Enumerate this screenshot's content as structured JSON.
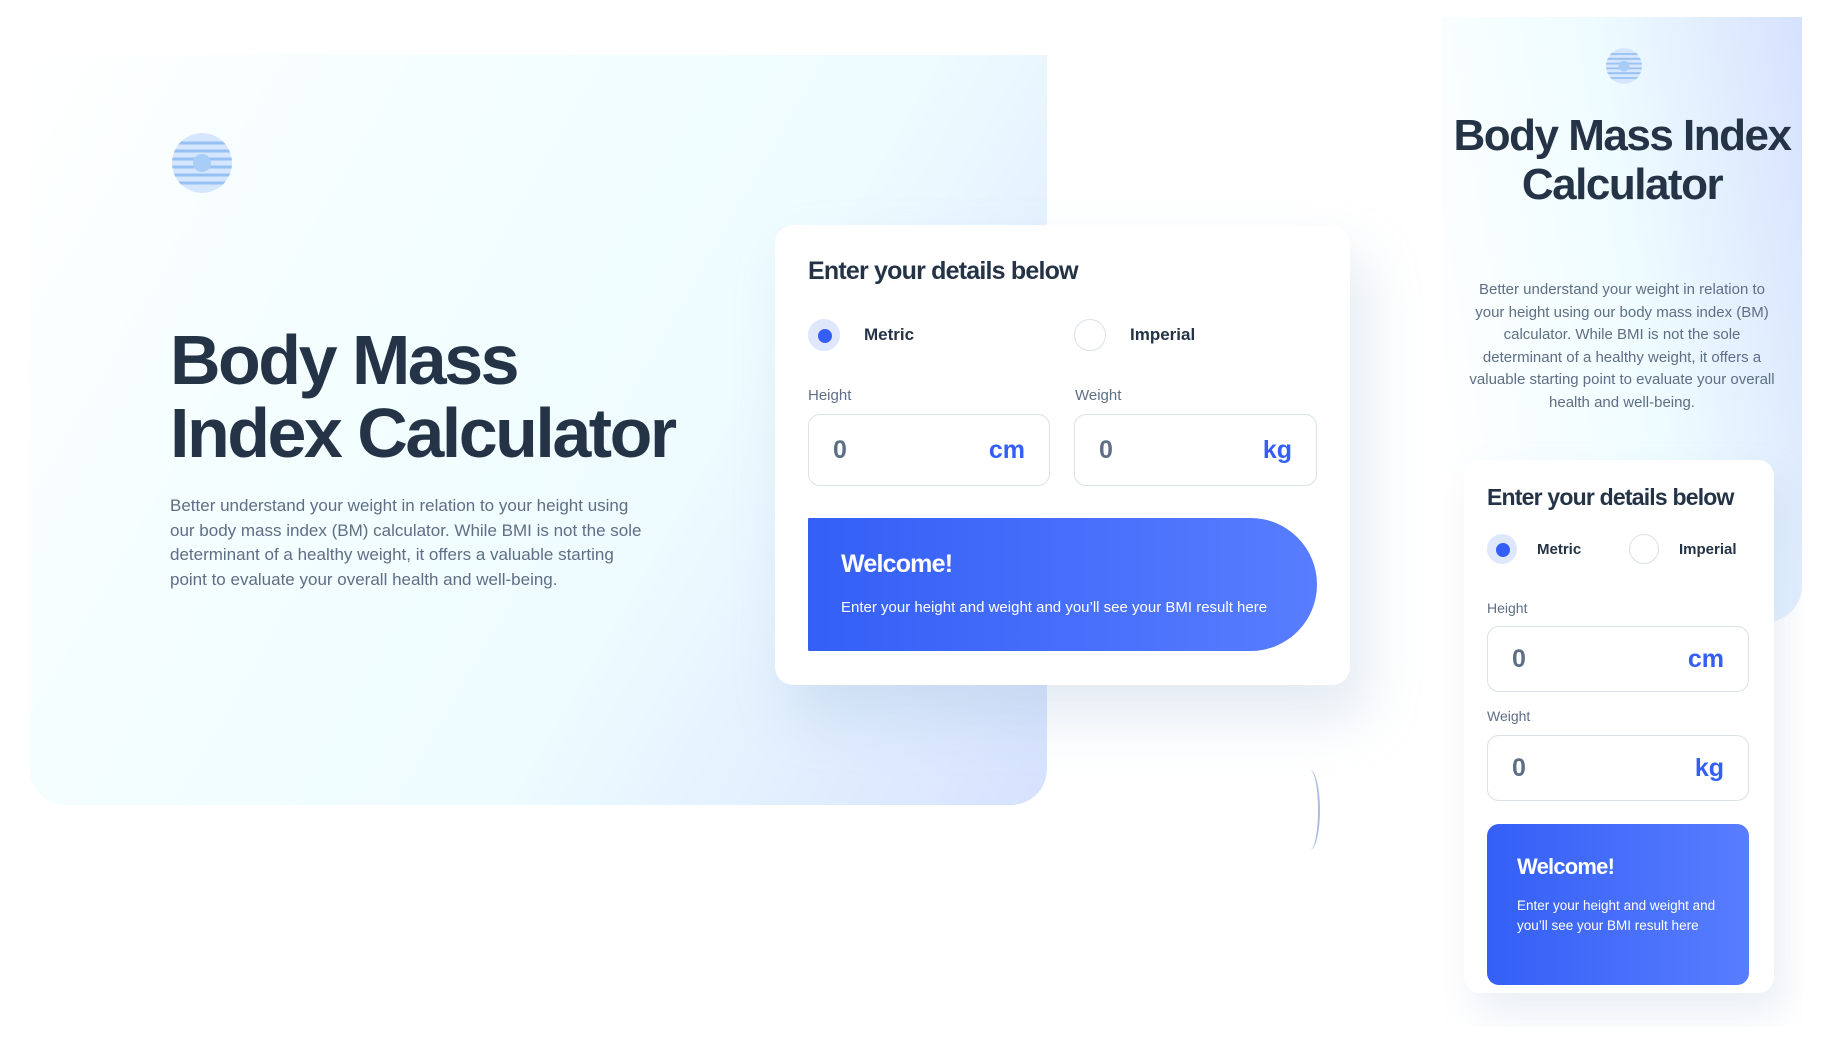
{
  "brand": {
    "accent": "#345ff6",
    "text_dark": "#253347",
    "text_muted": "#5e6e85",
    "logo_icon": "bmi-logo-icon"
  },
  "desktop": {
    "title": "Body Mass Index Calculator",
    "description": "Better understand your weight in relation to your height using our body mass index (BM) calculator. While BMI is not the sole determinant of a healthy weight, it offers a valuable starting point to evaluate your overall health and well-being.",
    "card": {
      "heading": "Enter your details below",
      "units": {
        "metric": "Metric",
        "imperial": "Imperial",
        "selected": "Metric"
      },
      "height": {
        "label": "Height",
        "value": "0",
        "unit": "cm"
      },
      "weight": {
        "label": "Weight",
        "value": "0",
        "unit": "kg"
      },
      "welcome": {
        "title": "Welcome!",
        "text": "Enter your height and weight and you’ll see your BMI result here"
      }
    }
  },
  "mobile": {
    "title": "Body Mass Index Calculator",
    "description": "Better understand your weight in relation to your height using our body mass index (BM) calculator. While BMI is not the sole determinant of a healthy weight, it offers a valuable starting point to evaluate your overall health and well-being.",
    "card": {
      "heading": "Enter your details below",
      "units": {
        "metric": "Metric",
        "imperial": "Imperial",
        "selected": "Metric"
      },
      "height": {
        "label": "Height",
        "value": "0",
        "unit": "cm"
      },
      "weight": {
        "label": "Weight",
        "value": "0",
        "unit": "kg"
      },
      "welcome": {
        "title": "Welcome!",
        "text": "Enter your height and weight and you’ll see your BMI result here"
      }
    }
  }
}
